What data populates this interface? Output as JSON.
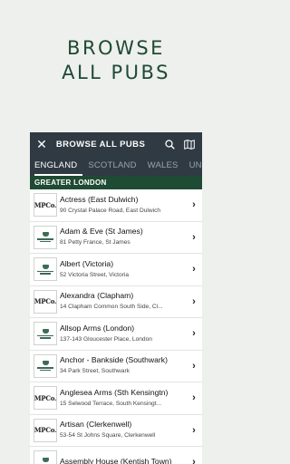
{
  "headline": {
    "line1": "BROWSE",
    "line2": "ALL PUBS"
  },
  "toolbar": {
    "title": "BROWSE ALL PUBS",
    "close_glyph": "✕",
    "search_icon": "search-icon",
    "map_icon": "map-icon"
  },
  "tabs": [
    {
      "label": "ENGLAND",
      "active": true
    },
    {
      "label": "SCOTLAND",
      "active": false
    },
    {
      "label": "WALES",
      "active": false
    },
    {
      "label": "UNITED",
      "active": false
    }
  ],
  "region": {
    "label": "GREATER LONDON"
  },
  "chevron": "›",
  "logos": {
    "mpc": "MPCo."
  },
  "pubs": [
    {
      "name": "Actress (East Dulwich)",
      "address": "90 Crystal Palace Road, East Dulwich",
      "logo": "mpc"
    },
    {
      "name": "Adam & Eve (St James)",
      "address": "81 Petty France, St James",
      "logo": "gk"
    },
    {
      "name": "Albert (Victoria)",
      "address": "52 Victoria Street, Victoria",
      "logo": "gk"
    },
    {
      "name": "Alexandra (Clapham)",
      "address": "14 Clapham Common South Side, Cl...",
      "logo": "mpc"
    },
    {
      "name": "Allsop Arms (London)",
      "address": "137-143 Gloucester Place, London",
      "logo": "gk"
    },
    {
      "name": "Anchor - Bankside (Southwark)",
      "address": "34 Park Street, Southwark",
      "logo": "gk"
    },
    {
      "name": "Anglesea Arms (Sth Kensingtn)",
      "address": "15 Selwood Terrace, South Kensingt...",
      "logo": "mpc"
    },
    {
      "name": "Artisan (Clerkenwell)",
      "address": "53-54 St Johns Square, Clerkenwell",
      "logo": "mpc"
    },
    {
      "name": "Assembly House (Kentish Town)",
      "address": "",
      "logo": "gk"
    }
  ]
}
